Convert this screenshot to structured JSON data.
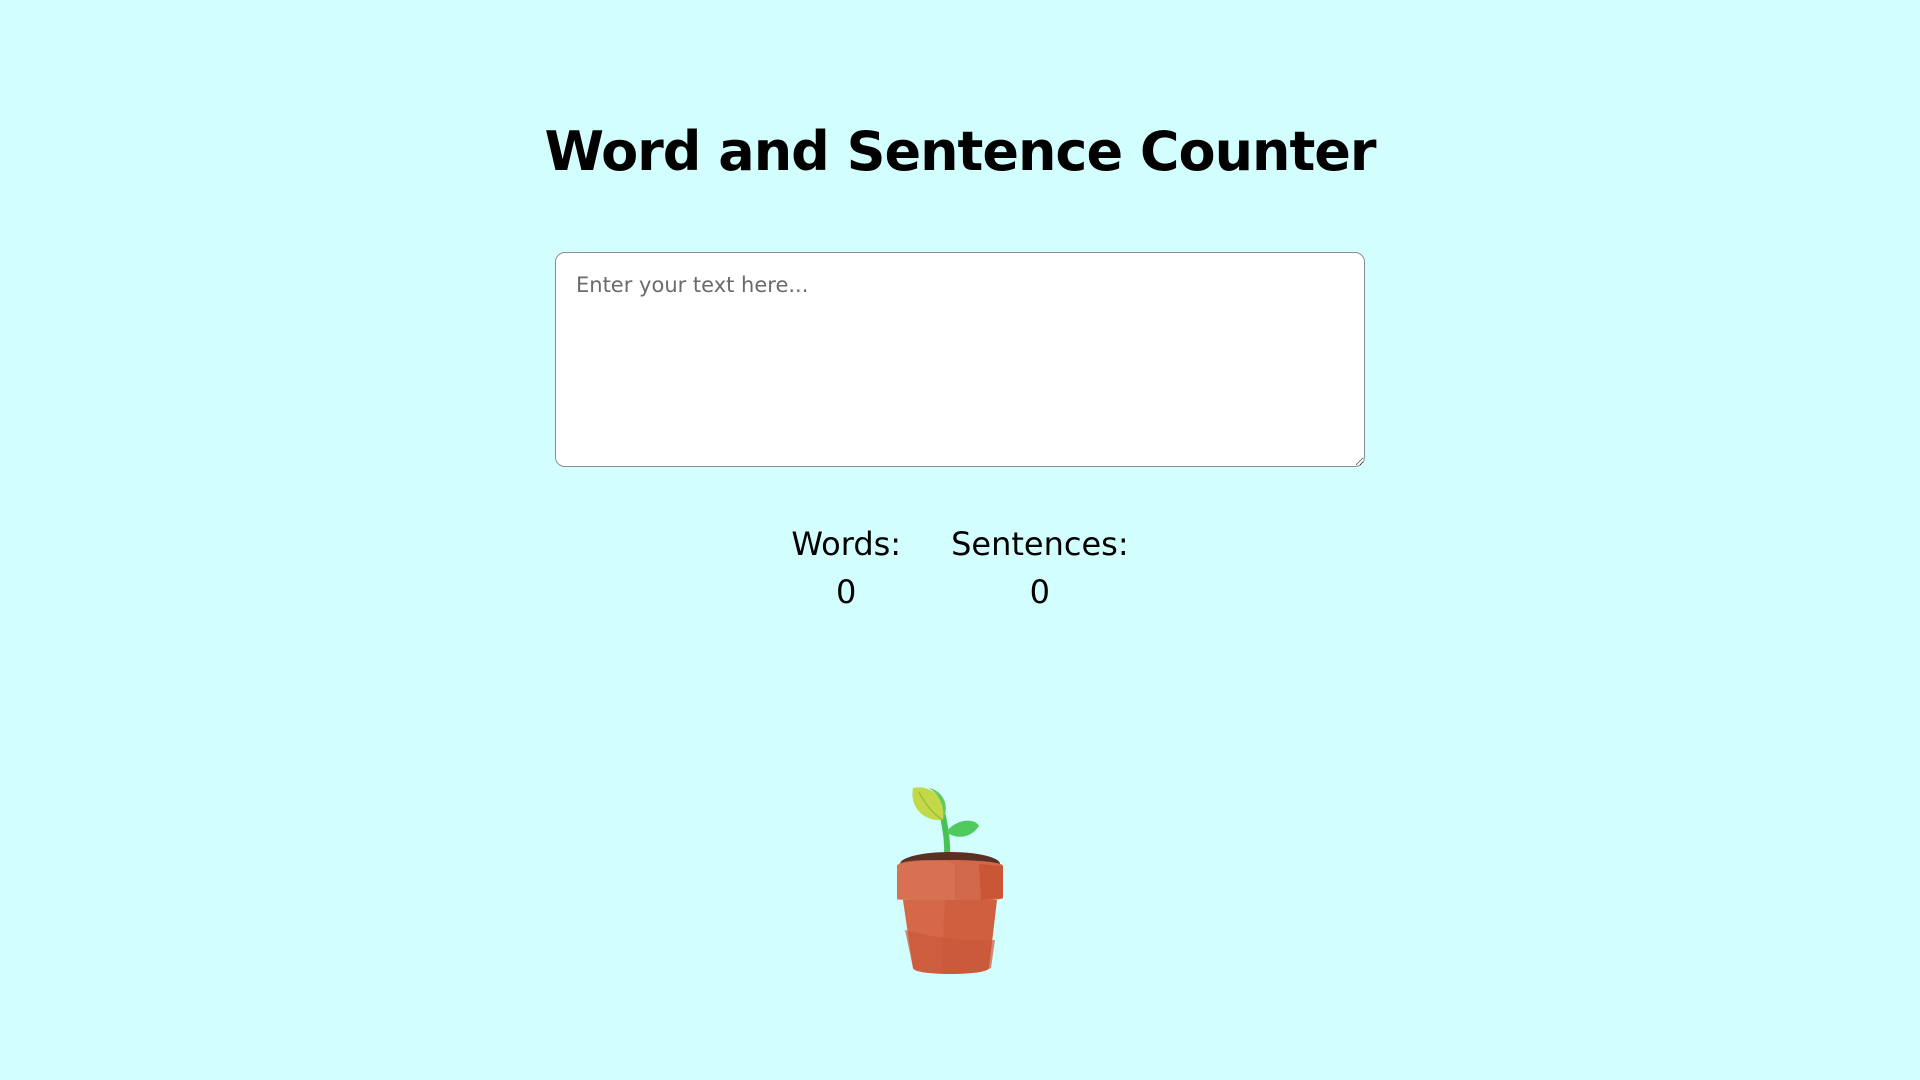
{
  "header": {
    "title": "Word and Sentence Counter"
  },
  "editor": {
    "placeholder": "Enter your text here...",
    "value": ""
  },
  "stats": {
    "words_label": "Words:",
    "words_value": "0",
    "sentences_label": "Sentences:",
    "sentences_value": "0"
  },
  "illustration": {
    "icon": "potted-plant-icon",
    "pot_color": "#d2684a",
    "leaf_color": "#52c85a",
    "soil_color": "#5a2f24"
  },
  "colors": {
    "background": "#d3fefe",
    "text": "#000000",
    "input_border": "#8e8e8e"
  }
}
